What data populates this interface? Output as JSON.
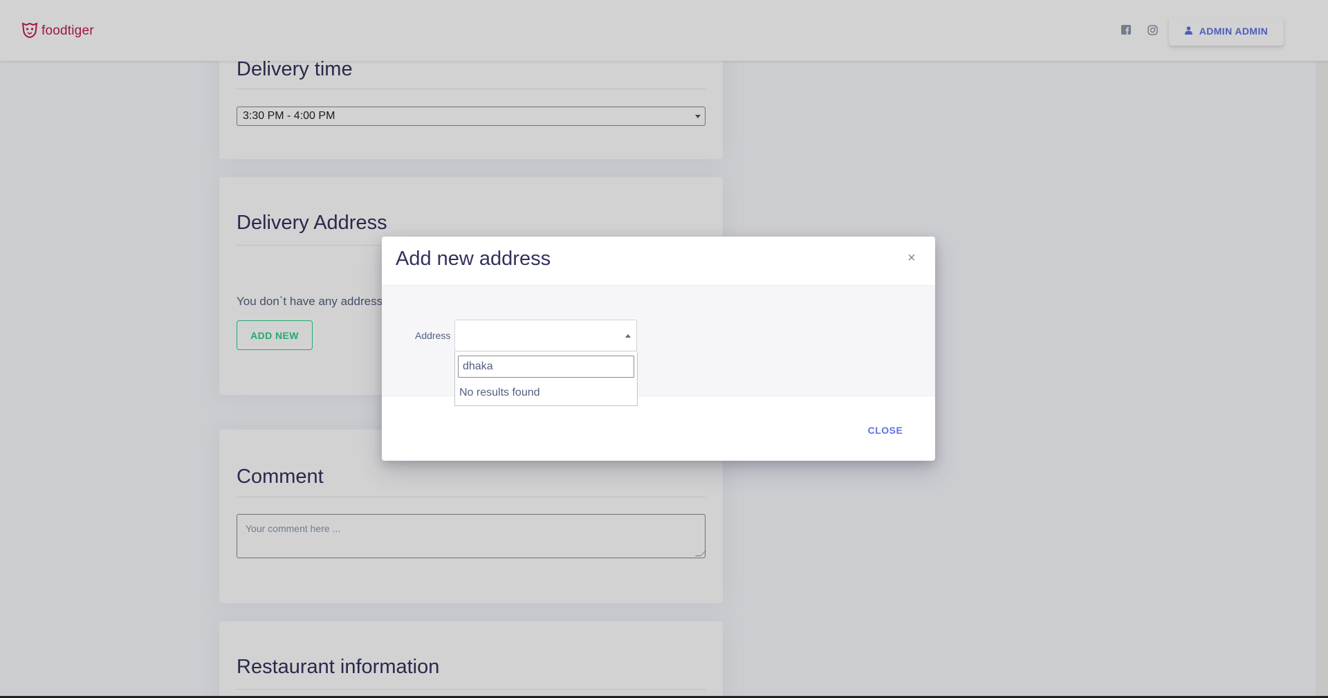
{
  "navbar": {
    "brand": "foodtiger",
    "user_button": "ADMIN ADMIN",
    "icons": [
      "facebook-square-icon",
      "instagram-icon",
      "user-icon"
    ]
  },
  "delivery_time": {
    "title": "Delivery time",
    "selected": "3:30 PM - 4:00 PM"
  },
  "delivery_address": {
    "title": "Delivery Address",
    "empty_note": "You don`t have any address.",
    "add_button": "ADD NEW"
  },
  "comment": {
    "title": "Comment",
    "placeholder": "Your comment here ..."
  },
  "restaurant": {
    "title": "Restaurant information"
  },
  "modal": {
    "title": "Add new address",
    "close_x": "×",
    "field_label": "Address",
    "search_value": "dhaka",
    "no_results": "No results found",
    "close_button": "CLOSE"
  },
  "colors": {
    "brand": "#c2185b",
    "primary": "#5e72e4",
    "success": "#2dce89",
    "heading": "#32325d"
  }
}
